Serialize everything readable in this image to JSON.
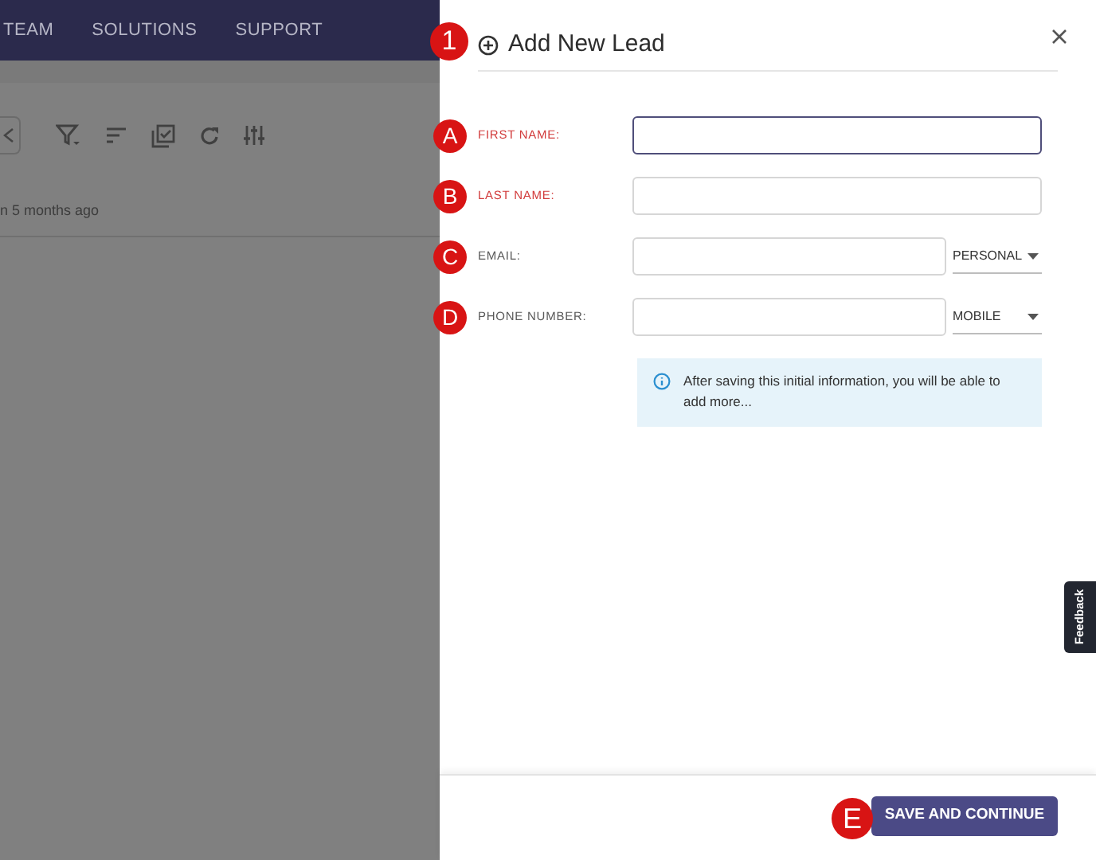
{
  "nav": {
    "items": [
      "TEAM",
      "SOLUTIONS",
      "SUPPORT"
    ]
  },
  "background": {
    "timestamp": "n 5 months ago"
  },
  "panel": {
    "title": "Add New Lead",
    "marker": "1",
    "fields": [
      {
        "kind": "text",
        "label": "FIRST NAME:",
        "required": true,
        "focused": true,
        "marker": "A"
      },
      {
        "kind": "text",
        "label": "LAST NAME:",
        "required": true,
        "focused": false,
        "marker": "B"
      },
      {
        "kind": "select",
        "label": "EMAIL:",
        "required": false,
        "focused": false,
        "marker": "C",
        "option": "PERSONAL"
      },
      {
        "kind": "select",
        "label": "PHONE NUMBER:",
        "required": false,
        "focused": false,
        "marker": "D",
        "option": "MOBILE"
      }
    ],
    "info": "After saving this initial information, you will be able to add more...",
    "submit": {
      "label": "SAVE AND CONTINUE",
      "marker": "E"
    }
  },
  "feedback_tab": "Feedback"
}
